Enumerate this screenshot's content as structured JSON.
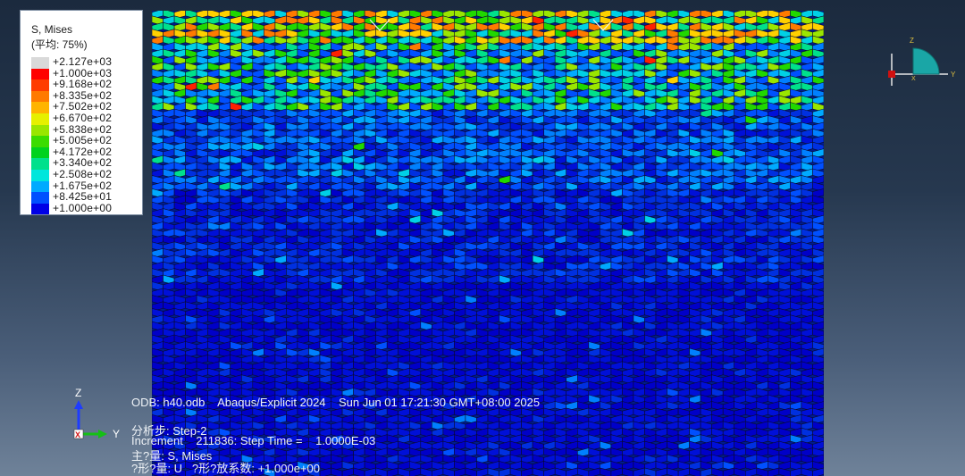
{
  "legend": {
    "title": "S, Mises",
    "subtitle": "(平均: 75%)",
    "entries": [
      {
        "value": "+2.127e+03",
        "color": "#d9d9d9"
      },
      {
        "value": "+1.000e+03",
        "color": "#ff0000"
      },
      {
        "value": "+9.168e+02",
        "color": "#ff3c00"
      },
      {
        "value": "+8.335e+02",
        "color": "#ff7a00"
      },
      {
        "value": "+7.502e+02",
        "color": "#ffb400"
      },
      {
        "value": "+6.670e+02",
        "color": "#e6f000"
      },
      {
        "value": "+5.838e+02",
        "color": "#9ae600"
      },
      {
        "value": "+5.005e+02",
        "color": "#3cdc00"
      },
      {
        "value": "+4.172e+02",
        "color": "#00d21e"
      },
      {
        "value": "+3.340e+02",
        "color": "#00e08c"
      },
      {
        "value": "+2.508e+02",
        "color": "#00e6dc"
      },
      {
        "value": "+1.675e+02",
        "color": "#00aaff"
      },
      {
        "value": "+8.425e+01",
        "color": "#0050ff"
      },
      {
        "value": "+1.000e+00",
        "color": "#0000e6"
      }
    ]
  },
  "info": {
    "odb_line": "ODB: h40.odb    Abaqus/Explicit 2024    Sun Jun 01 17:21:30 GMT+08:00 2025",
    "step_line": "分析步: Step-2",
    "increment_line": "Increment    211836: Step Time =    1.0000E-03",
    "primary_line": "主?量: S, Mises",
    "deformed_line": "?形?量: U   ?形?放系数: +1.000e+00"
  },
  "triad_left": {
    "z": "Z",
    "y": "Y",
    "x": "X"
  },
  "triad_right": {
    "z": "Z",
    "y": "Y",
    "x": "X"
  }
}
